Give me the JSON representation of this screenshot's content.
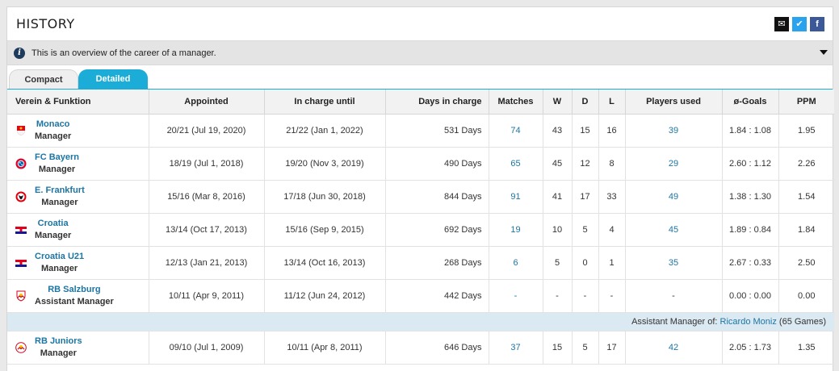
{
  "header": {
    "title": "HISTORY"
  },
  "info": {
    "text": "This is an overview of the career of a manager."
  },
  "tabs": [
    {
      "label": "Compact"
    },
    {
      "label": "Detailed"
    }
  ],
  "columns": [
    "Verein & Funktion",
    "Appointed",
    "In charge until",
    "Days in charge",
    "Matches",
    "W",
    "D",
    "L",
    "Players used",
    "ø-Goals",
    "PPM"
  ],
  "rows": [
    {
      "club": "Monaco",
      "role": "Manager",
      "appointed": "20/21 (Jul 19, 2020)",
      "until": "21/22 (Jan 1, 2022)",
      "days": "531 Days",
      "matches": "74",
      "w": "43",
      "d": "15",
      "l": "16",
      "players": "39",
      "goals": "1.84 : 1.08",
      "ppm": "1.95"
    },
    {
      "club": "FC Bayern",
      "role": "Manager",
      "appointed": "18/19 (Jul 1, 2018)",
      "until": "19/20 (Nov 3, 2019)",
      "days": "490 Days",
      "matches": "65",
      "w": "45",
      "d": "12",
      "l": "8",
      "players": "29",
      "goals": "2.60 : 1.12",
      "ppm": "2.26"
    },
    {
      "club": "E. Frankfurt",
      "role": "Manager",
      "appointed": "15/16 (Mar 8, 2016)",
      "until": "17/18 (Jun 30, 2018)",
      "days": "844 Days",
      "matches": "91",
      "w": "41",
      "d": "17",
      "l": "33",
      "players": "49",
      "goals": "1.38 : 1.30",
      "ppm": "1.54"
    },
    {
      "club": "Croatia",
      "role": "Manager",
      "appointed": "13/14 (Oct 17, 2013)",
      "until": "15/16 (Sep 9, 2015)",
      "days": "692 Days",
      "matches": "19",
      "w": "10",
      "d": "5",
      "l": "4",
      "players": "45",
      "goals": "1.89 : 0.84",
      "ppm": "1.84"
    },
    {
      "club": "Croatia U21",
      "role": "Manager",
      "appointed": "12/13 (Jan 21, 2013)",
      "until": "13/14 (Oct 16, 2013)",
      "days": "268 Days",
      "matches": "6",
      "w": "5",
      "d": "0",
      "l": "1",
      "players": "35",
      "goals": "2.67 : 0.33",
      "ppm": "2.50"
    },
    {
      "club": "RB Salzburg",
      "role": "Assistant Manager",
      "appointed": "10/11 (Apr 9, 2011)",
      "until": "11/12 (Jun 24, 2012)",
      "days": "442 Days",
      "matches": "-",
      "w": "-",
      "d": "-",
      "l": "-",
      "players": "-",
      "goals": "0.00 : 0.00",
      "ppm": "0.00"
    },
    {
      "club": "RB Juniors",
      "role": "Manager",
      "appointed": "09/10 (Jul 1, 2009)",
      "until": "10/11 (Apr 8, 2011)",
      "days": "646 Days",
      "matches": "37",
      "w": "15",
      "d": "5",
      "l": "17",
      "players": "42",
      "goals": "2.05 : 1.73",
      "ppm": "1.35"
    }
  ],
  "note": {
    "prefix": "Assistant Manager of:",
    "name": "Ricardo Moniz",
    "suffix": "(65 Games)"
  }
}
